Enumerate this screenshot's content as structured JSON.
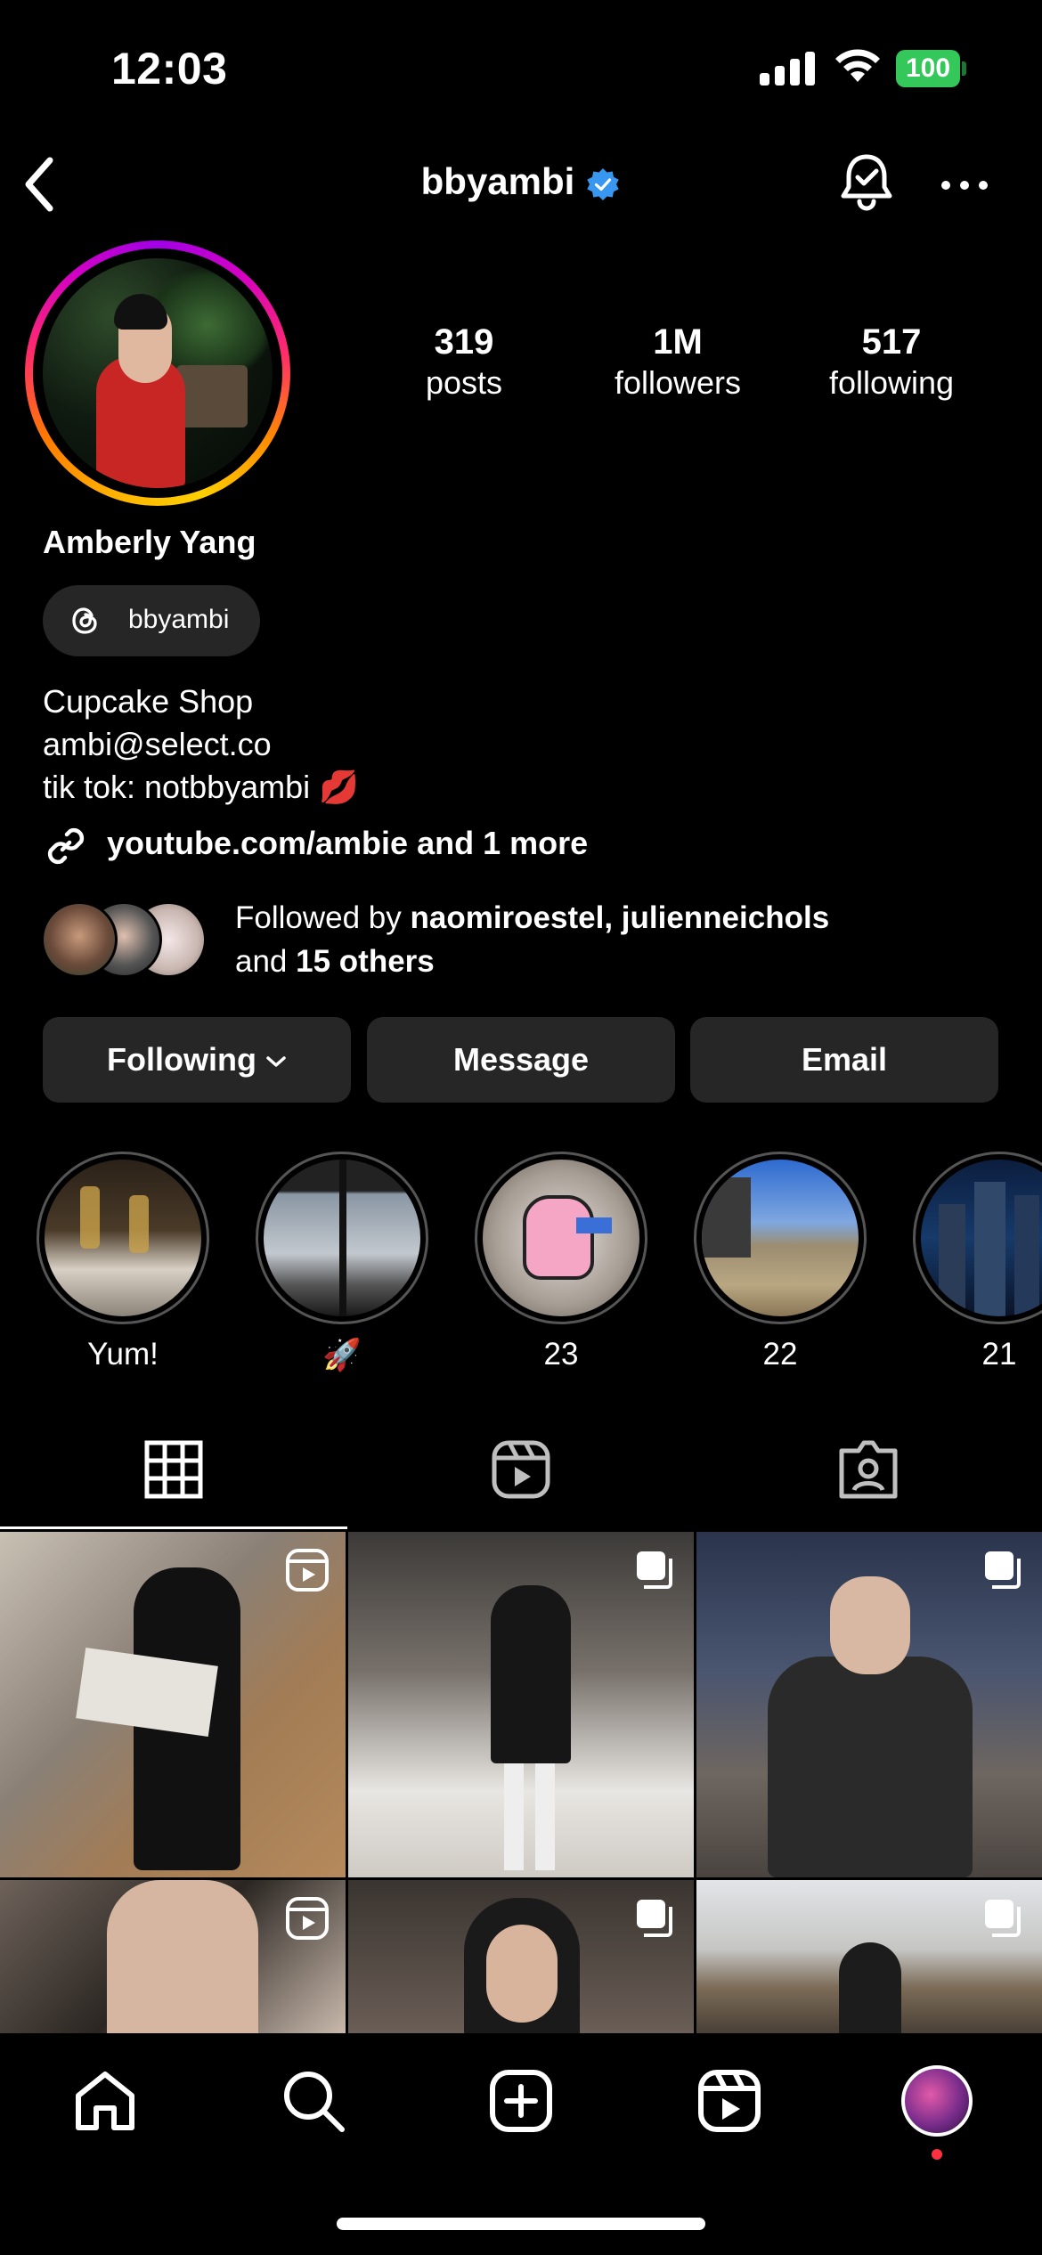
{
  "status_bar": {
    "time": "12:03",
    "battery": "100"
  },
  "nav": {
    "username": "bbyambi"
  },
  "profile": {
    "full_name": "Amberly Yang",
    "threads_handle": "bbyambi",
    "stats": [
      {
        "value": "319",
        "label": "posts"
      },
      {
        "value": "1M",
        "label": "followers"
      },
      {
        "value": "517",
        "label": "following"
      }
    ],
    "bio": [
      "Cupcake Shop",
      "ambi@select.co",
      "tik tok: notbbyambi 💋"
    ],
    "link": "youtube.com/ambie and 1 more",
    "followed_by": {
      "prefix": "Followed by ",
      "users": "naomiroestel, julienneichols",
      "middle": "and ",
      "others": "15 others"
    }
  },
  "buttons": {
    "following": "Following",
    "message": "Message",
    "email": "Email"
  },
  "highlights": [
    {
      "caption": "Yum!"
    },
    {
      "caption": "🚀"
    },
    {
      "caption": "23"
    },
    {
      "caption": "22"
    },
    {
      "caption": "21"
    }
  ],
  "colors": {
    "verified": "#3897f0",
    "button_bg": "#262626",
    "notification_dot": "#ff3040"
  }
}
